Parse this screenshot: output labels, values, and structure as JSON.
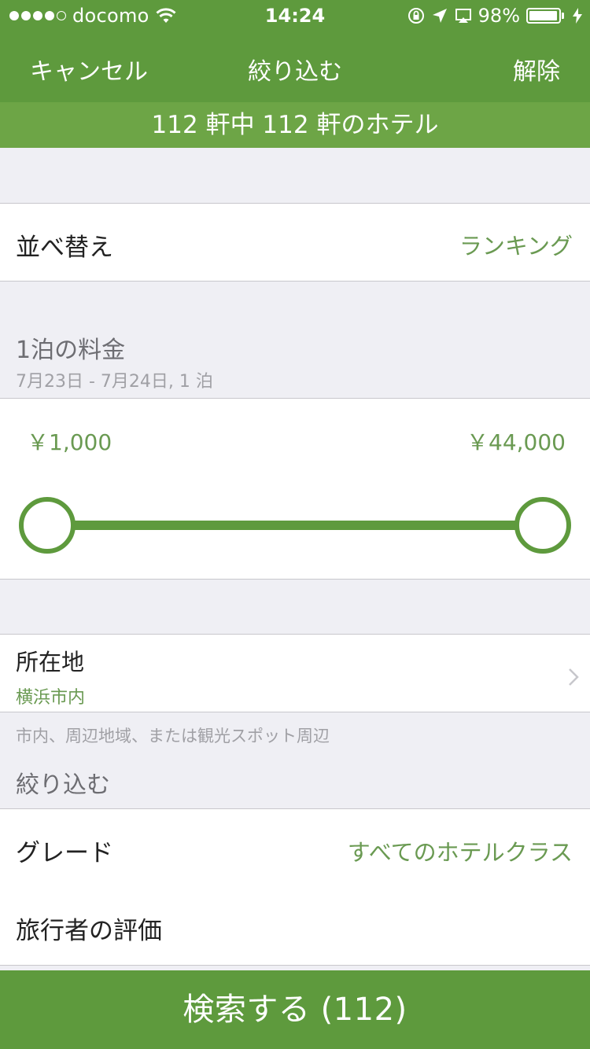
{
  "status_bar": {
    "carrier": "docomo",
    "time": "14:24",
    "battery": "98%",
    "battery_level": 0.98
  },
  "nav": {
    "cancel_label": "キャンセル",
    "title": "絞り込む",
    "clear_label": "解除"
  },
  "results_summary": "112 軒中 112 軒のホテル",
  "sort": {
    "label": "並べ替え",
    "value": "ランキング"
  },
  "price": {
    "title": "1泊の料金",
    "dates": "7月23日 - 7月24日, 1 泊",
    "min_label": "￥1,000",
    "max_label": "￥44,000",
    "range_min_fraction": 0.0,
    "range_max_fraction": 1.0
  },
  "location": {
    "label": "所在地",
    "value": "横浜市内",
    "hint": "市内、周辺地域、または観光スポット周辺"
  },
  "filter_header": "絞り込む",
  "grade": {
    "label": "グレード",
    "value": "すべてのホテルクラス"
  },
  "rating": {
    "label": "旅行者の評価"
  },
  "search_button": "検索する (112)",
  "colors": {
    "brand_green": "#5e9a3d",
    "value_green": "#6a9a52"
  },
  "icons": {
    "wifi": "wifi-icon",
    "lock_rotation": "rotation-lock-icon",
    "location": "location-arrow-icon",
    "airplay": "airplay-icon",
    "battery": "battery-icon",
    "charging": "charging-bolt-icon",
    "chevron": "chevron-right-icon"
  }
}
